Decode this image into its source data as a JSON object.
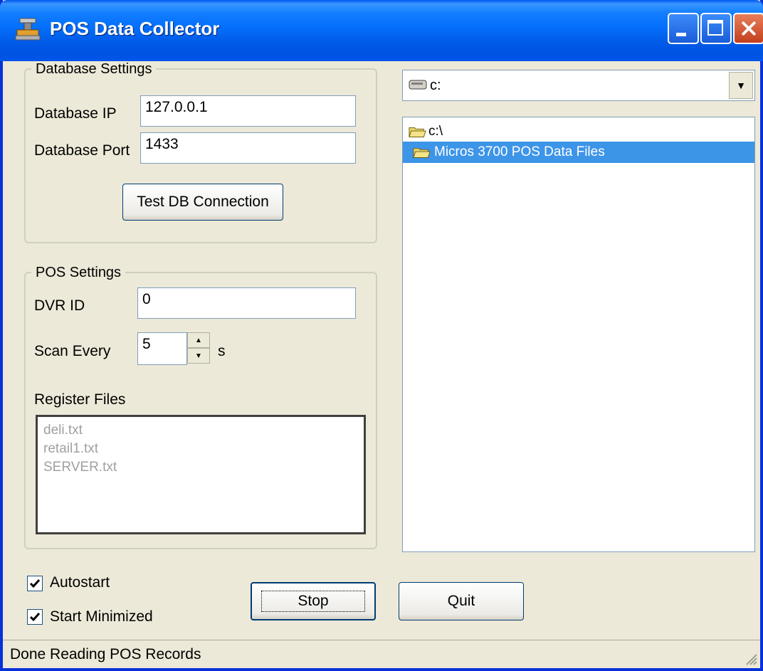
{
  "window": {
    "title": "POS Data Collector"
  },
  "database_settings": {
    "group_label": "Database Settings",
    "ip_label": "Database IP",
    "ip_value": "127.0.0.1",
    "port_label": "Database Port",
    "port_value": "1433",
    "test_button": "Test DB Connection"
  },
  "pos_settings": {
    "group_label": "POS Settings",
    "dvr_label": "DVR ID",
    "dvr_value": "0",
    "scan_label": "Scan Every",
    "scan_value": "5",
    "scan_unit": "s",
    "register_label": "Register Files",
    "register_files": [
      "deli.txt",
      "retail1.txt",
      "SERVER.txt"
    ]
  },
  "browser": {
    "drive": "c:",
    "tree": [
      {
        "label": "c:\\",
        "selected": false
      },
      {
        "label": "Micros 3700 POS Data Files",
        "selected": true
      }
    ]
  },
  "options": {
    "autostart_label": "Autostart",
    "autostart_checked": true,
    "start_minimized_label": "Start Minimized",
    "start_minimized_checked": true
  },
  "buttons": {
    "stop": "Stop",
    "quit": "Quit"
  },
  "status": {
    "text": "Done Reading POS Records"
  },
  "colors": {
    "title_blue": "#0054e3",
    "selection_blue": "#3d95e8",
    "window_face": "#ece9d8",
    "close_red": "#d7582b"
  }
}
